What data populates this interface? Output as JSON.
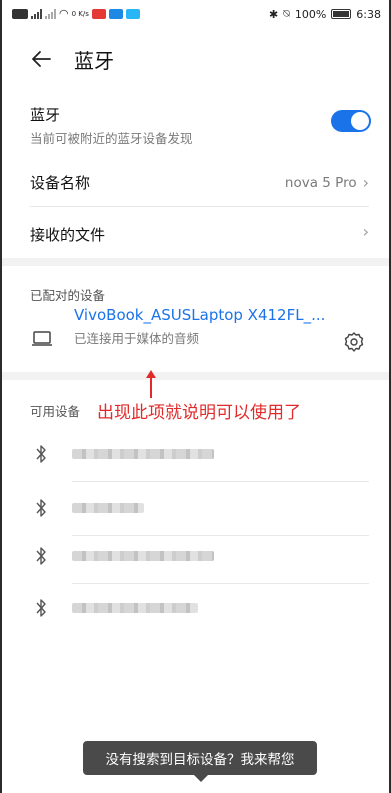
{
  "status_bar": {
    "speed": "0 K/s",
    "battery": "100%",
    "time": "6:38"
  },
  "header": {
    "title": "蓝牙"
  },
  "bluetooth": {
    "label": "蓝牙",
    "sub": "当前可被附近的蓝牙设备发现",
    "enabled": true
  },
  "device_name": {
    "label": "设备名称",
    "value": "nova 5 Pro"
  },
  "received_files": {
    "label": "接收的文件"
  },
  "paired": {
    "title": "已配对的设备",
    "device": {
      "name": "VivoBook_ASUSLaptop X412FL_...",
      "status": "已连接用于媒体的音频"
    }
  },
  "available": {
    "title": "可用设备",
    "annotation": "出现此项就说明可以使用了",
    "devices": [
      {
        "name": "",
        "icon": "bluetooth-icon"
      },
      {
        "name": "",
        "icon": "bluetooth-icon"
      },
      {
        "name": "",
        "icon": "bluetooth-icon"
      },
      {
        "name": "",
        "icon": "bluetooth-icon"
      }
    ]
  },
  "help_tip": {
    "text": "没有搜索到目标设备？我来帮您"
  },
  "colors": {
    "accent": "#1a73e8",
    "annotation": "#e12b2b"
  }
}
